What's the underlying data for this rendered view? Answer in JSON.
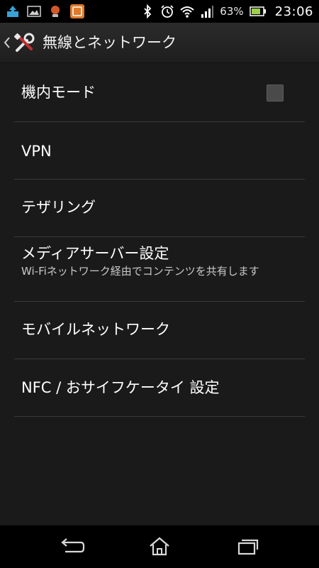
{
  "status_bar": {
    "notifications": [
      "upload-icon",
      "image-icon",
      "app-notification-icon",
      "media-app-icon"
    ],
    "battery_percent": "63%",
    "time": "23:06",
    "icons": [
      "bluetooth-icon",
      "alarm-icon",
      "wifi-icon",
      "signal-icon",
      "battery-icon"
    ]
  },
  "action_bar": {
    "title": "無線とネットワーク",
    "icon": "tools-icon"
  },
  "settings": {
    "items": [
      {
        "title": "機内モード",
        "checked": false
      },
      {
        "title": "VPN"
      },
      {
        "title": "テザリング"
      },
      {
        "title": "メディアサーバー設定",
        "summary": "Wi-Fiネットワーク経由でコンテンツを共有します"
      },
      {
        "title": "モバイルネットワーク"
      },
      {
        "title": "NFC / おサイフケータイ 設定"
      }
    ]
  },
  "nav": {
    "buttons": [
      "back-icon",
      "home-icon",
      "recent-apps-icon"
    ]
  },
  "colors": {
    "background": "#1a1a1a",
    "divider": "#3a3a3a",
    "text_primary": "#ffffff",
    "text_secondary": "#c8c8c8"
  }
}
